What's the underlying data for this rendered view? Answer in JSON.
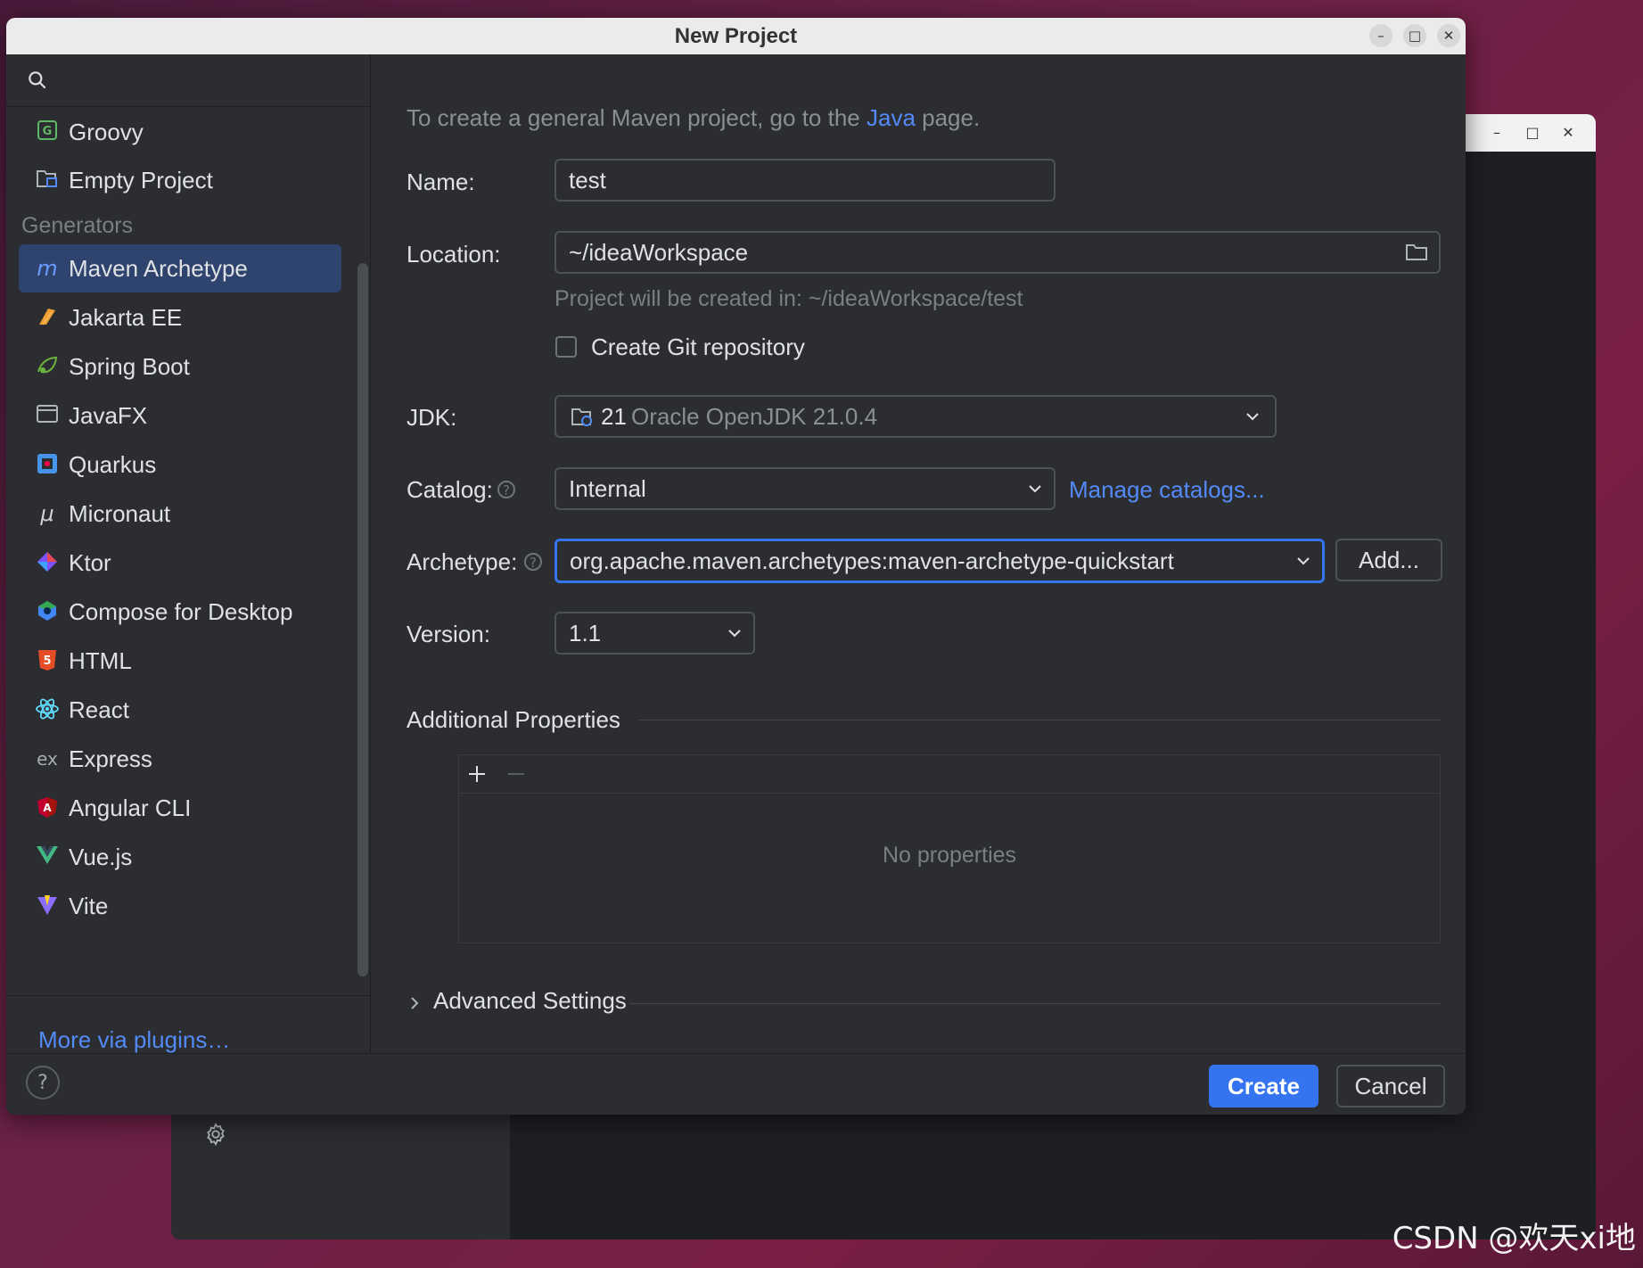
{
  "dialog": {
    "title": "New Project"
  },
  "sidebar": {
    "top_items": [
      {
        "label": "Groovy",
        "icon": "groovy-icon"
      },
      {
        "label": "Empty Project",
        "icon": "empty-project-icon"
      }
    ],
    "section_label": "Generators",
    "generators": [
      {
        "label": "Maven Archetype",
        "icon": "maven-icon",
        "selected": true
      },
      {
        "label": "Jakarta EE",
        "icon": "jakarta-icon"
      },
      {
        "label": "Spring Boot",
        "icon": "spring-icon"
      },
      {
        "label": "JavaFX",
        "icon": "javafx-icon"
      },
      {
        "label": "Quarkus",
        "icon": "quarkus-icon"
      },
      {
        "label": "Micronaut",
        "icon": "micronaut-icon"
      },
      {
        "label": "Ktor",
        "icon": "ktor-icon"
      },
      {
        "label": "Compose for Desktop",
        "icon": "compose-icon"
      },
      {
        "label": "HTML",
        "icon": "html-icon"
      },
      {
        "label": "React",
        "icon": "react-icon"
      },
      {
        "label": "Express",
        "icon": "express-icon"
      },
      {
        "label": "Angular CLI",
        "icon": "angular-icon"
      },
      {
        "label": "Vue.js",
        "icon": "vue-icon"
      },
      {
        "label": "Vite",
        "icon": "vite-icon"
      }
    ],
    "more_link": "More via plugins…"
  },
  "form": {
    "intro_prefix": "To create a general Maven project, go to the ",
    "intro_link": "Java",
    "intro_suffix": " page.",
    "name_label": "Name:",
    "name_value": "test",
    "location_label": "Location:",
    "location_value": "~/ideaWorkspace",
    "location_hint": "Project will be created in: ~/ideaWorkspace/test",
    "git_label": "Create Git repository",
    "jdk_label": "JDK:",
    "jdk_version": "21",
    "jdk_name": "Oracle OpenJDK 21.0.4",
    "catalog_label": "Catalog:",
    "catalog_value": "Internal",
    "manage_catalogs": "Manage catalogs...",
    "archetype_label": "Archetype:",
    "archetype_value": "org.apache.maven.archetypes:maven-archetype-quickstart",
    "add_button": "Add...",
    "version_label": "Version:",
    "version_value": "1.1",
    "additional_properties": "Additional Properties",
    "no_properties": "No properties",
    "advanced_settings": "Advanced Settings"
  },
  "footer": {
    "help": "?",
    "create": "Create",
    "cancel": "Cancel"
  },
  "watermark": "CSDN @欢天xi地",
  "colors": {
    "accent": "#3574f0",
    "link": "#548af7",
    "selection": "#2e436e",
    "panel": "#2b2d30"
  }
}
